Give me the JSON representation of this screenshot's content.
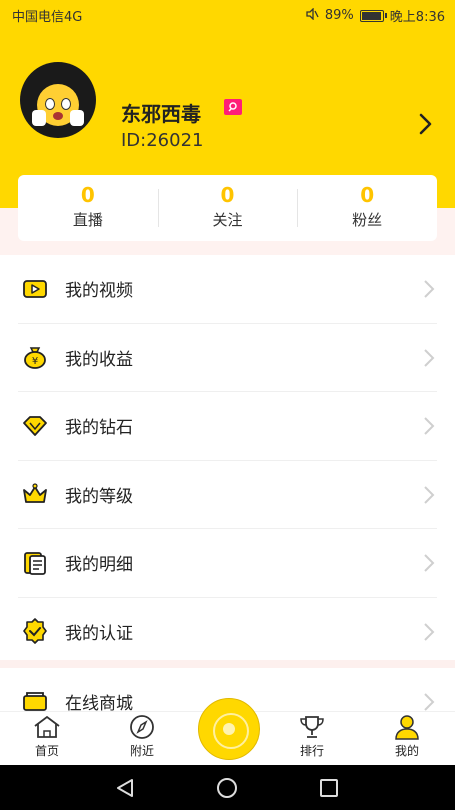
{
  "status_bar": {
    "carrier": "中国电信4G",
    "battery": "89%",
    "time": "晚上8:36"
  },
  "profile": {
    "name": "东邪西毒",
    "id": "ID:26021"
  },
  "stats": [
    {
      "value": "0",
      "label": "直播"
    },
    {
      "value": "0",
      "label": "关注"
    },
    {
      "value": "0",
      "label": "粉丝"
    }
  ],
  "menu": [
    {
      "label": "我的视频",
      "icon": "video-icon"
    },
    {
      "label": "我的收益",
      "icon": "money-bag-icon"
    },
    {
      "label": "我的钻石",
      "icon": "diamond-icon"
    },
    {
      "label": "我的等级",
      "icon": "crown-icon"
    },
    {
      "label": "我的明细",
      "icon": "document-icon"
    },
    {
      "label": "我的认证",
      "icon": "verified-badge-icon"
    },
    {
      "label": "在线商城",
      "icon": "shop-cart-icon"
    }
  ],
  "bottom_nav": [
    {
      "label": "首页",
      "icon": "home-icon"
    },
    {
      "label": "附近",
      "icon": "compass-icon"
    },
    {
      "label": "排行",
      "icon": "trophy-icon"
    },
    {
      "label": "我的",
      "icon": "user-icon"
    }
  ],
  "colors": {
    "accent": "#ffd800",
    "stat_number": "#ffc400",
    "badge": "#ff1e78"
  }
}
